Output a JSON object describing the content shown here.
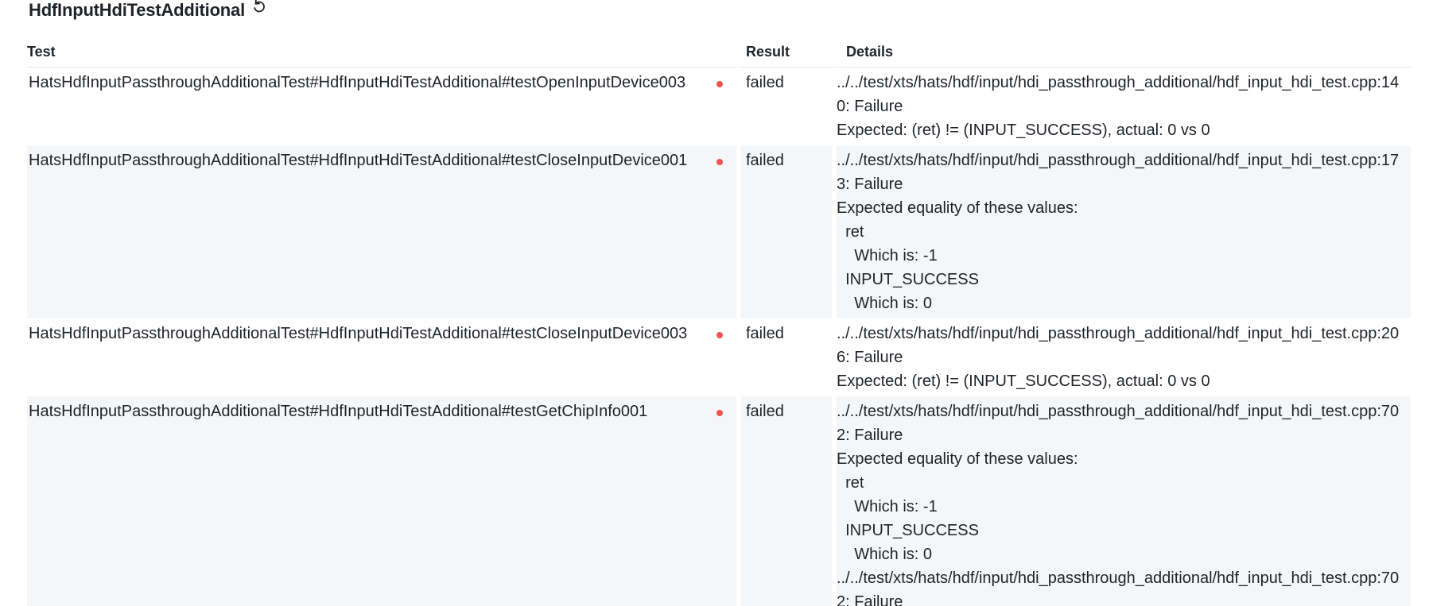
{
  "suite": {
    "title": "HdfInputHdiTestAdditional",
    "refresh_icon": "refresh-icon"
  },
  "table": {
    "columns": {
      "test": "Test",
      "result": "Result",
      "details": "Details"
    },
    "rows": [
      {
        "test": "HatsHdfInputPassthroughAdditionalTest#HdfInputHdiTestAdditional#testOpenInputDevice003",
        "result": "failed",
        "details": "../../test/xts/hats/hdf/input/hdi_passthrough_additional/hdf_input_hdi_test.cpp:140: Failure\nExpected: (ret) != (INPUT_SUCCESS), actual: 0 vs 0"
      },
      {
        "test": "HatsHdfInputPassthroughAdditionalTest#HdfInputHdiTestAdditional#testCloseInputDevice001",
        "result": "failed",
        "details": "../../test/xts/hats/hdf/input/hdi_passthrough_additional/hdf_input_hdi_test.cpp:173: Failure\nExpected equality of these values:\n  ret\n    Which is: -1\n  INPUT_SUCCESS\n    Which is: 0"
      },
      {
        "test": "HatsHdfInputPassthroughAdditionalTest#HdfInputHdiTestAdditional#testCloseInputDevice003",
        "result": "failed",
        "details": "../../test/xts/hats/hdf/input/hdi_passthrough_additional/hdf_input_hdi_test.cpp:206: Failure\nExpected: (ret) != (INPUT_SUCCESS), actual: 0 vs 0"
      },
      {
        "test": "HatsHdfInputPassthroughAdditionalTest#HdfInputHdiTestAdditional#testGetChipInfo001",
        "result": "failed",
        "details": "../../test/xts/hats/hdf/input/hdi_passthrough_additional/hdf_input_hdi_test.cpp:702: Failure\nExpected equality of these values:\n  ret\n    Which is: -1\n  INPUT_SUCCESS\n    Which is: 0\n../../test/xts/hats/hdf/input/hdi_passthrough_additional/hdf_input_hdi_test.cpp:702: Failure"
      }
    ]
  },
  "colors": {
    "failed_dot": "#ef5350",
    "row_stripe": "#f5f6f8",
    "text": "#1f2329"
  }
}
